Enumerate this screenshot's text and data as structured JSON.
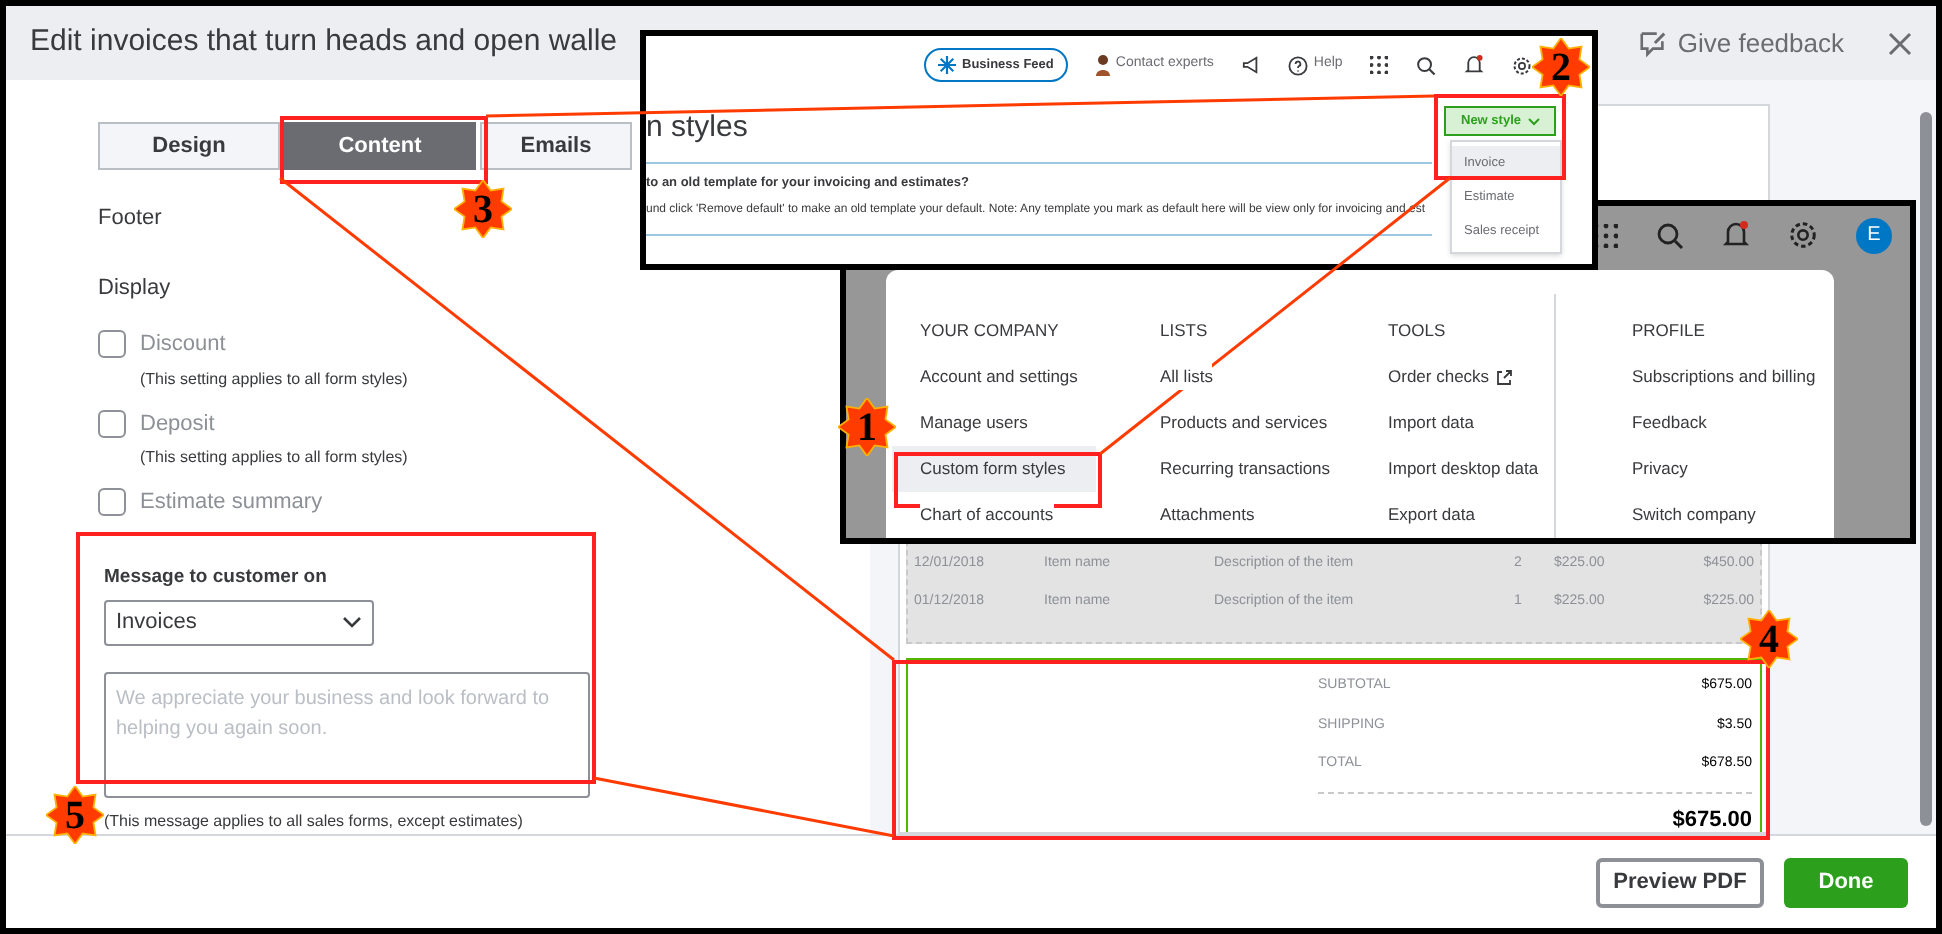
{
  "dialog": {
    "title": "Edit invoices that turn heads and open walle",
    "feedback": "Give feedback"
  },
  "tabs": [
    {
      "label": "Design",
      "selected": false
    },
    {
      "label": "Content",
      "selected": true
    },
    {
      "label": "Emails",
      "selected": false
    }
  ],
  "footer_label": "Footer",
  "display_label": "Display",
  "display_options": [
    {
      "label": "Discount",
      "checked": false,
      "note": "(This setting applies to all form styles)"
    },
    {
      "label": "Deposit",
      "checked": false,
      "note": "(This setting applies to all form styles)"
    },
    {
      "label": "Estimate summary",
      "checked": false
    }
  ],
  "message": {
    "label": "Message to customer on",
    "select_value": "Invoices",
    "placeholder": "We appreciate your business and look forward to helping you again soon.",
    "note": "(This message applies to all sales forms, except estimates)"
  },
  "preview": {
    "rows": [
      [
        "12/01/2018",
        "Item name",
        "Description of the item",
        "2",
        "$225.00",
        "$450.00"
      ],
      [
        "01/12/2018",
        "Item name",
        "Description of the item",
        "1",
        "$225.00",
        "$225.00"
      ]
    ],
    "totals": [
      {
        "label": "SUBTOTAL",
        "value": "$675.00"
      },
      {
        "label": "SHIPPING",
        "value": "$3.50"
      },
      {
        "label": "TOTAL",
        "value": "$678.50"
      }
    ],
    "balance_due": "$675.00"
  },
  "footer_buttons": [
    {
      "label": "Preview PDF",
      "kind": "secondary"
    },
    {
      "label": "Done",
      "kind": "primary"
    }
  ],
  "styles_inset": {
    "nav": {
      "feed": "Business Feed",
      "contact": "Contact experts",
      "help": "Help"
    },
    "heading": "n styles",
    "new_style": "New style",
    "new_style_options": [
      {
        "label": "Invoice",
        "selected": true
      },
      {
        "label": "Estimate",
        "selected": false
      },
      {
        "label": "Sales receipt",
        "selected": false
      }
    ],
    "notice_title": "to an old template for your invoicing and estimates?",
    "notice_text": "und click 'Remove default' to make an old template your default. Note: Any template you mark as default here will be view only for invoicing and est"
  },
  "menu_inset": {
    "avatar": "E",
    "columns": [
      {
        "heading": "YOUR COMPANY",
        "items": [
          {
            "label": "Account and settings",
            "selected": false,
            "kind": "link"
          },
          {
            "label": "Manage users",
            "selected": false,
            "kind": "link"
          },
          {
            "label": "Custom form styles",
            "selected": true,
            "kind": "link"
          },
          {
            "label": "Chart of accounts",
            "selected": false,
            "kind": "link"
          }
        ]
      },
      {
        "heading": "LISTS",
        "items": [
          {
            "label": "All lists",
            "selected": false,
            "kind": "link"
          },
          {
            "label": "Products and services",
            "selected": false,
            "kind": "link"
          },
          {
            "label": "Recurring transactions",
            "selected": false,
            "kind": "link"
          },
          {
            "label": "Attachments",
            "selected": false,
            "kind": "link"
          }
        ]
      },
      {
        "heading": "TOOLS",
        "items": [
          {
            "label": "Order checks",
            "selected": false,
            "kind": "external_link"
          },
          {
            "label": "Import data",
            "selected": false,
            "kind": "link"
          },
          {
            "label": "Import desktop data",
            "selected": false,
            "kind": "link"
          },
          {
            "label": "Export data",
            "selected": false,
            "kind": "link"
          }
        ]
      },
      {
        "heading": "PROFILE",
        "items": [
          {
            "label": "Subscriptions and billing",
            "selected": false,
            "kind": "link"
          },
          {
            "label": "Feedback",
            "selected": false,
            "kind": "link"
          },
          {
            "label": "Privacy",
            "selected": false,
            "kind": "link"
          },
          {
            "label": "Switch company",
            "selected": false,
            "kind": "link"
          }
        ]
      }
    ]
  },
  "annotations": [
    {
      "number": "1"
    },
    {
      "number": "2"
    },
    {
      "number": "3"
    },
    {
      "number": "4"
    },
    {
      "number": "5"
    }
  ]
}
